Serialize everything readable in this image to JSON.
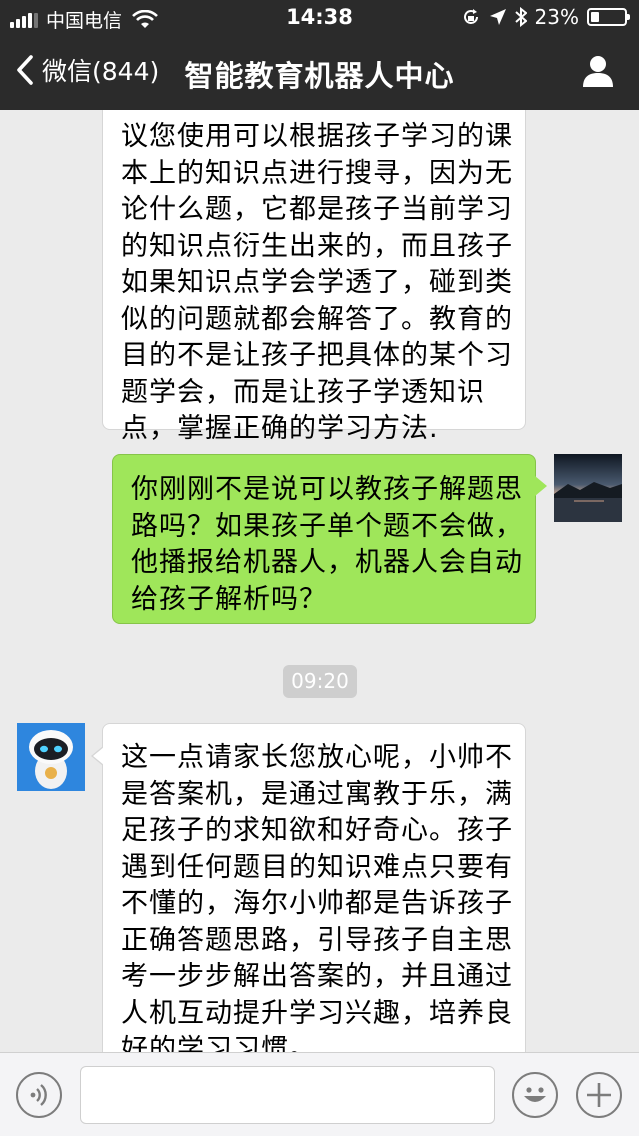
{
  "status_bar": {
    "carrier": "中国电信",
    "time": "14:38",
    "battery": "23%",
    "battery_level": 0.23
  },
  "nav": {
    "back_label": "微信(844)",
    "title": "智能教育机器人中心"
  },
  "messages": [
    {
      "side": "in",
      "lines": [
        "议您使用可以根据孩子学习的课",
        "本上的知识点进行搜寻，因为无",
        "论什么题，它都是孩子当前学习",
        "的知识点衍生出来的，而且孩子",
        "如果知识点学会学透了，碰到类",
        "似的问题就都会解答了。教育的",
        "目的不是让孩子把具体的某个习",
        "题学会，而是让孩子学透知识",
        "点，掌握正确的学习方法."
      ]
    },
    {
      "side": "out",
      "lines": [
        "你刚刚不是说可以教孩子解题思",
        "路吗？如果孩子单个题不会做，",
        "他播报给机器人，机器人会自动",
        "给孩子解析吗？"
      ]
    },
    {
      "side": "in",
      "lines": [
        "这一点请家长您放心呢，小帅不",
        "是答案机，是通过寓教于乐，满",
        "足孩子的求知欲和好奇心。孩子",
        "遇到任何题目的知识难点只要有",
        "不懂的，海尔小帅都是告诉孩子",
        "正确答题思路，引导孩子自主思",
        "考一步步解出答案的，并且通过",
        "人机互动提升学习兴趣，培养良",
        "好的学习习惯。"
      ]
    }
  ],
  "timestamp": "09:20",
  "input": {
    "value": "",
    "placeholder": ""
  },
  "colors": {
    "nav_bg": "#2b2b2b",
    "chat_bg": "#ebebeb",
    "outgoing_bubble": "#9fe65a",
    "incoming_bubble": "#ffffff"
  },
  "icons": [
    "signal-icon",
    "wifi-icon",
    "lock-rotation-icon",
    "location-icon",
    "bluetooth-icon",
    "battery-icon",
    "back-chevron-icon",
    "profile-icon",
    "voice-icon",
    "emoji-icon",
    "plus-icon"
  ]
}
